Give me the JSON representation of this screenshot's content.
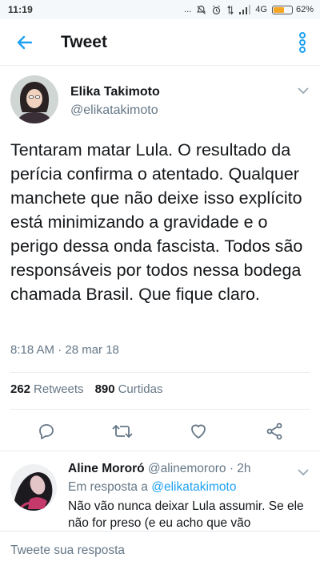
{
  "status_bar": {
    "time": "11:19",
    "dots": "...",
    "network": "4G",
    "battery_percent_label": "62%",
    "battery_level": 0.62
  },
  "header": {
    "title": "Tweet",
    "back_icon": "arrow-left-icon",
    "more_icon": "vertical-dots-icon"
  },
  "tweet": {
    "author_name": "Elika Takimoto",
    "author_handle": "@elikatakimoto",
    "text": "Tentaram matar Lula. O resultado da perícia confirma o atentado. Qualquer manchete que não deixe isso explícito está minimizando a gravidade e o perigo dessa onda fascista. Todos são responsáveis por todos nessa bodega chamada Brasil. Que fique claro.",
    "timestamp": "8:18 AM · 28 mar 18",
    "retweets_count": "262",
    "retweets_label": "Retweets",
    "likes_count": "890",
    "likes_label": "Curtidas"
  },
  "actions": {
    "reply_icon": "reply-icon",
    "retweet_icon": "retweet-icon",
    "like_icon": "heart-icon",
    "share_icon": "share-icon"
  },
  "reply": {
    "author_name": "Aline Mororó",
    "author_handle": "@alinemororo",
    "time": "2h",
    "in_reply_prefix": "Em resposta a",
    "in_reply_handle": "@elikatakimoto",
    "text": "Não vão nunca deixar Lula assumir. Se ele não for preso (e eu acho que vão"
  },
  "composer": {
    "placeholder": "Tweete sua resposta"
  },
  "colors": {
    "accent": "#1da1f2",
    "text_primary": "#14171a",
    "text_secondary": "#657786",
    "divider": "#e6ecf0",
    "battery": "#f5a623"
  }
}
